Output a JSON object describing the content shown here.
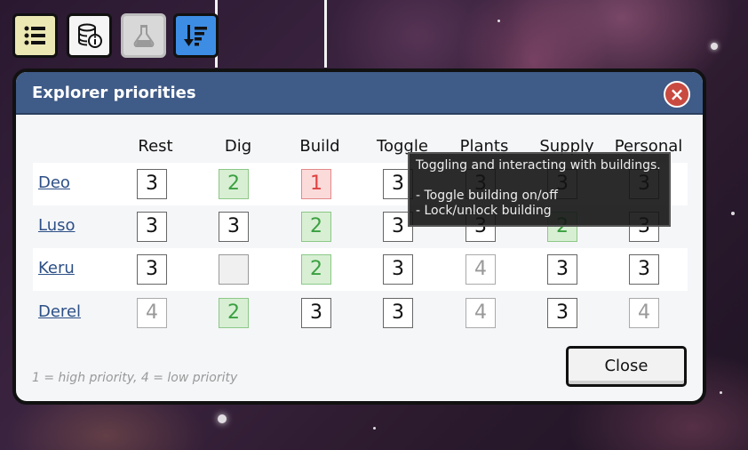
{
  "toolbar": {
    "buttons": [
      {
        "name": "list-button",
        "icon": "list-icon",
        "bg": "#ece8b4"
      },
      {
        "name": "database-info-button",
        "icon": "database-info-icon",
        "bg": "#f5f5f5"
      },
      {
        "name": "flask-button",
        "icon": "flask-icon",
        "bg": "#d8d8d8"
      },
      {
        "name": "sort-button",
        "icon": "sort-icon",
        "bg": "#3d8de4"
      }
    ]
  },
  "dialog": {
    "title": "Explorer priorities",
    "close_icon": "×",
    "columns": [
      "Rest",
      "Dig",
      "Build",
      "Toggle",
      "Plants",
      "Supply",
      "Personal"
    ],
    "rows": [
      {
        "name": "Deo",
        "values": [
          "3",
          "2",
          "1",
          "3",
          "3",
          "3",
          "3"
        ]
      },
      {
        "name": "Luso",
        "values": [
          "3",
          "3",
          "2",
          "3",
          "3",
          "2",
          "3"
        ]
      },
      {
        "name": "Keru",
        "values": [
          "3",
          "",
          "2",
          "3",
          "4",
          "3",
          "3"
        ]
      },
      {
        "name": "Derel",
        "values": [
          "4",
          "2",
          "3",
          "3",
          "4",
          "3",
          "4"
        ]
      }
    ],
    "footnote": "1 = high priority, 4 = low priority",
    "close_label": "Close"
  },
  "tooltip": {
    "text": "Toggling and interacting with buildings.\n\n- Toggle building on/off\n- Lock/unlock building"
  },
  "colors": {
    "header": "#3f5b88",
    "priority_1": "#e04040",
    "priority_2": "#3aa040",
    "close_red": "#c94a40"
  }
}
